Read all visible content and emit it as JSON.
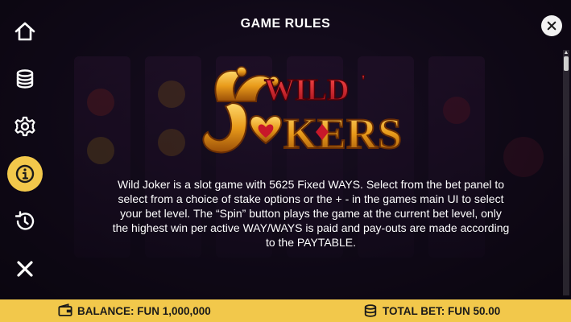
{
  "header": {
    "title": "GAME RULES"
  },
  "logo": {
    "text": "WILD JOKERS"
  },
  "rules": {
    "text": "Wild Joker is a slot game with 5625 Fixed WAYS. Select from the bet panel to select from a choice of stake options or the + - in the games main UI to select your bet level. The “Spin” button plays the game at the current bet level, only the highest win per active WAY/WAYS is paid and pay-outs are made according to the PAYTABLE."
  },
  "footer": {
    "balance_label": "BALANCE: FUN 1,000,000",
    "total_bet_label": "TOTAL BET: FUN 50.00"
  },
  "sidebar": {
    "items": [
      {
        "icon": "home-icon"
      },
      {
        "icon": "coins-icon"
      },
      {
        "icon": "gear-icon"
      },
      {
        "icon": "info-icon",
        "active": true
      },
      {
        "icon": "history-icon"
      },
      {
        "icon": "close-icon"
      }
    ]
  },
  "colors": {
    "accent": "#f2c84b",
    "text": "#ffffff",
    "logo_red": "#c8182a",
    "logo_gold": "#e8a020"
  }
}
